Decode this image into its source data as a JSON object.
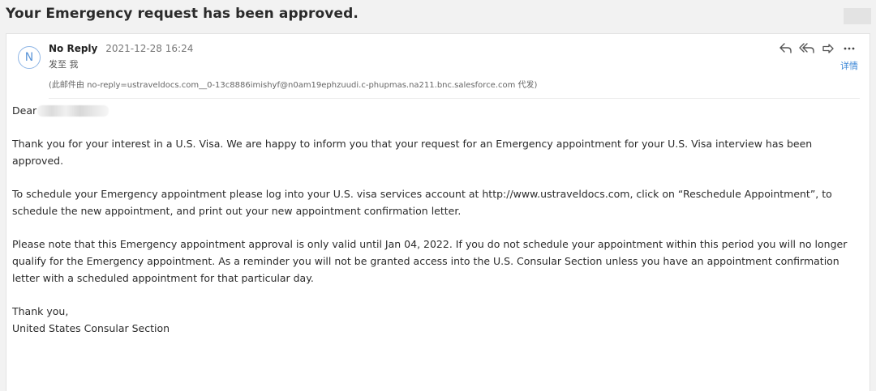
{
  "subject": "Your Emergency request has been approved.",
  "sender": {
    "avatar_letter": "N",
    "name": "No Reply",
    "datetime": "2021-12-28 16:24",
    "to_line": "发至 我",
    "via_line": "(此邮件由 no-reply=ustraveldocs.com__0-13c8886imishyf@n0am19ephzuudi.c-phupmas.na211.bnc.salesforce.com 代发)"
  },
  "toolbar": {
    "details_label": "详情",
    "more_label": "…"
  },
  "icons": {
    "reply": "reply-icon",
    "reply_all": "reply-all-icon",
    "forward": "forward-icon",
    "more": "more-icon"
  },
  "colors": {
    "link": "#3a86d6",
    "avatar": "#5b95d8"
  },
  "message": {
    "greeting": "Dear",
    "paragraphs": [
      "Thank you for your interest in a U.S. Visa.  We are happy to inform you that your request for an Emergency appointment for your U.S. Visa interview has been approved.",
      "To schedule your Emergency appointment please log into your U.S. visa services account at http://www.ustraveldocs.com, click on “Reschedule Appointment”, to schedule the new appointment, and print out your new appointment confirmation letter.",
      "Please note that this Emergency appointment approval is only valid until Jan 04, 2022.  If you do not schedule your appointment within this period you will no longer qualify for the Emergency appointment.  As a reminder you will not be granted access into the U.S. Consular Section unless you have an appointment confirmation letter with a scheduled appointment for that particular day."
    ],
    "signoff": "Thank you,",
    "signature": "United States Consular Section"
  }
}
